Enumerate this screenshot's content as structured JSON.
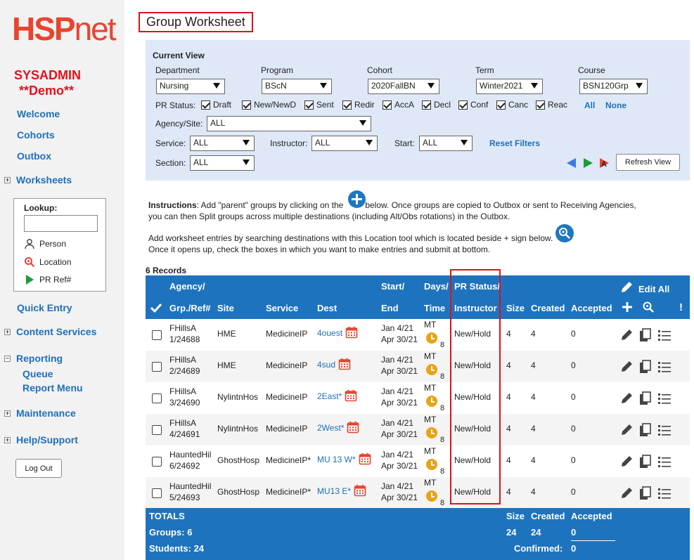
{
  "brand": {
    "logo_left": "HSP",
    "logo_right": "net",
    "user": "SYSADMIN",
    "mode": "**Demo**"
  },
  "nav": {
    "welcome": "Welcome",
    "cohorts": "Cohorts",
    "outbox": "Outbox",
    "worksheets": "Worksheets",
    "quick_entry": "Quick Entry",
    "content_services": "Content Services",
    "reporting": "Reporting",
    "queue": "Queue",
    "report_menu": "Report Menu",
    "maintenance": "Maintenance",
    "help_support": "Help/Support",
    "logout": "Log Out"
  },
  "lookup": {
    "title": "Lookup:",
    "person": "Person",
    "location": "Location",
    "pr_ref": "PR Ref#"
  },
  "page": {
    "title": "Group Worksheet"
  },
  "current_view": {
    "heading": "Current View",
    "department_label": "Department",
    "department": "Nursing",
    "program_label": "Program",
    "program": "BScN",
    "cohort_label": "Cohort",
    "cohort": "2020FallBN",
    "term_label": "Term",
    "term": "Winter2021",
    "course_label": "Course",
    "course": "BSN120Grp",
    "pr_status_label": "PR Status:",
    "statuses": [
      "Draft",
      "New/NewD",
      "Sent",
      "Redir",
      "AccA",
      "Decl",
      "Conf",
      "Canc",
      "Reac"
    ],
    "all": "All",
    "none": "None",
    "agency_label": "Agency/Site:",
    "agency": "ALL",
    "service_label": "Service:",
    "service": "ALL",
    "instructor_label": "Instructor:",
    "instructor": "ALL",
    "start_label": "Start:",
    "start": "ALL",
    "reset": "Reset Filters",
    "section_label": "Section:",
    "section": "ALL",
    "refresh": "Refresh View"
  },
  "instructions": {
    "bold": "Instructions",
    "line1a": ":  Add \"parent\" groups by clicking on the",
    "line1b": "below. Once groups are copied to Outbox or sent to Receiving Agencies,",
    "line2": "you can then Split groups across multiple destinations (including Alt/Obs rotations) in the Outbox.",
    "line3": "Add worksheet entries by searching destinations with this Location tool which is located beside + sign below.",
    "line4": "Once it opens up, check the boxes in which you want to make entries and submit at bottom."
  },
  "records_label": "6 Records",
  "table_headers": {
    "agency": "Agency/",
    "grp_ref": "Grp./Ref#",
    "site": "Site",
    "service": "Service",
    "dest": "Dest",
    "start": "Start/",
    "end": "End",
    "days": "Days/",
    "time": "Time",
    "pr_status": "PR Status/",
    "instructor": "Instructor",
    "size": "Size",
    "created": "Created",
    "accepted": "Accepted",
    "edit_all": "Edit All",
    "bang": "!"
  },
  "rows": [
    {
      "agency": "FHillsA",
      "grp": "1/24688",
      "site": "HME",
      "service": "MedicineIP",
      "dest": "4ouest",
      "start": "Jan 4/21",
      "end": "Apr 30/21",
      "days": "MT",
      "hours": "8",
      "status": "New/Hold",
      "size": "4",
      "created": "4",
      "accepted": "0"
    },
    {
      "agency": "FHillsA",
      "grp": "2/24689",
      "site": "HME",
      "service": "MedicineIP",
      "dest": "4sud",
      "start": "Jan 4/21",
      "end": "Apr 30/21",
      "days": "MT",
      "hours": "8",
      "status": "New/Hold",
      "size": "4",
      "created": "4",
      "accepted": "0"
    },
    {
      "agency": "FHillsA",
      "grp": "3/24690",
      "site": "NylintnHos",
      "service": "MedicineIP",
      "dest": "2East*",
      "start": "Jan 4/21",
      "end": "Apr 30/21",
      "days": "MT",
      "hours": "8",
      "status": "New/Hold",
      "size": "4",
      "created": "4",
      "accepted": "0"
    },
    {
      "agency": "FHillsA",
      "grp": "4/24691",
      "site": "NylintnHos",
      "service": "MedicineIP",
      "dest": "2West*",
      "start": "Jan 4/21",
      "end": "Apr 30/21",
      "days": "MT",
      "hours": "8",
      "status": "New/Hold",
      "size": "4",
      "created": "4",
      "accepted": "0"
    },
    {
      "agency": "HauntedHil",
      "grp": "6/24692",
      "site": "GhostHosp",
      "service": "MedicineIP*",
      "dest": "MU 13 W*",
      "start": "Jan 4/21",
      "end": "Apr 30/21",
      "days": "MT",
      "hours": "8",
      "status": "New/Hold",
      "size": "4",
      "created": "4",
      "accepted": "0"
    },
    {
      "agency": "HauntedHil",
      "grp": "5/24693",
      "site": "GhostHosp",
      "service": "MedicineIP*",
      "dest": "MU13 E*",
      "start": "Jan 4/21",
      "end": "Apr 30/21",
      "days": "MT",
      "hours": "8",
      "status": "New/Hold",
      "size": "4",
      "created": "4",
      "accepted": "0"
    }
  ],
  "totals": {
    "title": "TOTALS",
    "groups_label": "Groups:",
    "groups": "6",
    "students_label": "Students:",
    "students": "24",
    "size_label": "Size",
    "created_label": "Created",
    "accepted_label": "Accepted",
    "size": "24",
    "created": "24",
    "accepted": "0",
    "confirmed_label": "Confirmed:",
    "confirmed": "0"
  },
  "colors": {
    "brand_red": "#e8442f",
    "primary_blue": "#1e73be",
    "link_blue": "#1f6fb8",
    "highlight_red": "#d9141a",
    "filter_bg": "#dfe8f7"
  }
}
